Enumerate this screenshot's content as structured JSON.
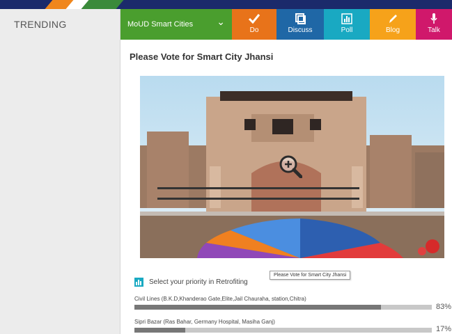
{
  "sidebar": {
    "title": "TRENDING"
  },
  "nav": {
    "dropdown_label": "MoUD Smart Cities",
    "tabs": [
      {
        "label": "Do",
        "icon": "check-icon"
      },
      {
        "label": "Discuss",
        "icon": "discuss-icon"
      },
      {
        "label": "Poll",
        "icon": "poll-icon"
      },
      {
        "label": "Blog",
        "icon": "pencil-icon"
      },
      {
        "label": "Talk",
        "icon": "microphone-icon"
      }
    ]
  },
  "poll": {
    "title": "Please Vote for Smart City Jhansi",
    "tooltip": "Please Vote for Smart City Jhansi",
    "prompt": "Select your priority in Retrofiting",
    "options": [
      {
        "label": "Civil Lines (B.K.D,Khanderao Gate,Elite,Jail Chauraha, station,Chitra)",
        "percent_text": "83%",
        "percent": 83
      },
      {
        "label": "Sipri Bazar (Ras Bahar, Germany Hospital, Masiha Ganj)",
        "percent_text": "17%",
        "percent": 17
      }
    ]
  },
  "colors": {
    "nav_dropdown": "#4a9e2e",
    "do": "#e8731a",
    "discuss": "#1f67a6",
    "poll": "#19a9c2",
    "blog": "#f6a21a",
    "talk": "#d0186b"
  }
}
